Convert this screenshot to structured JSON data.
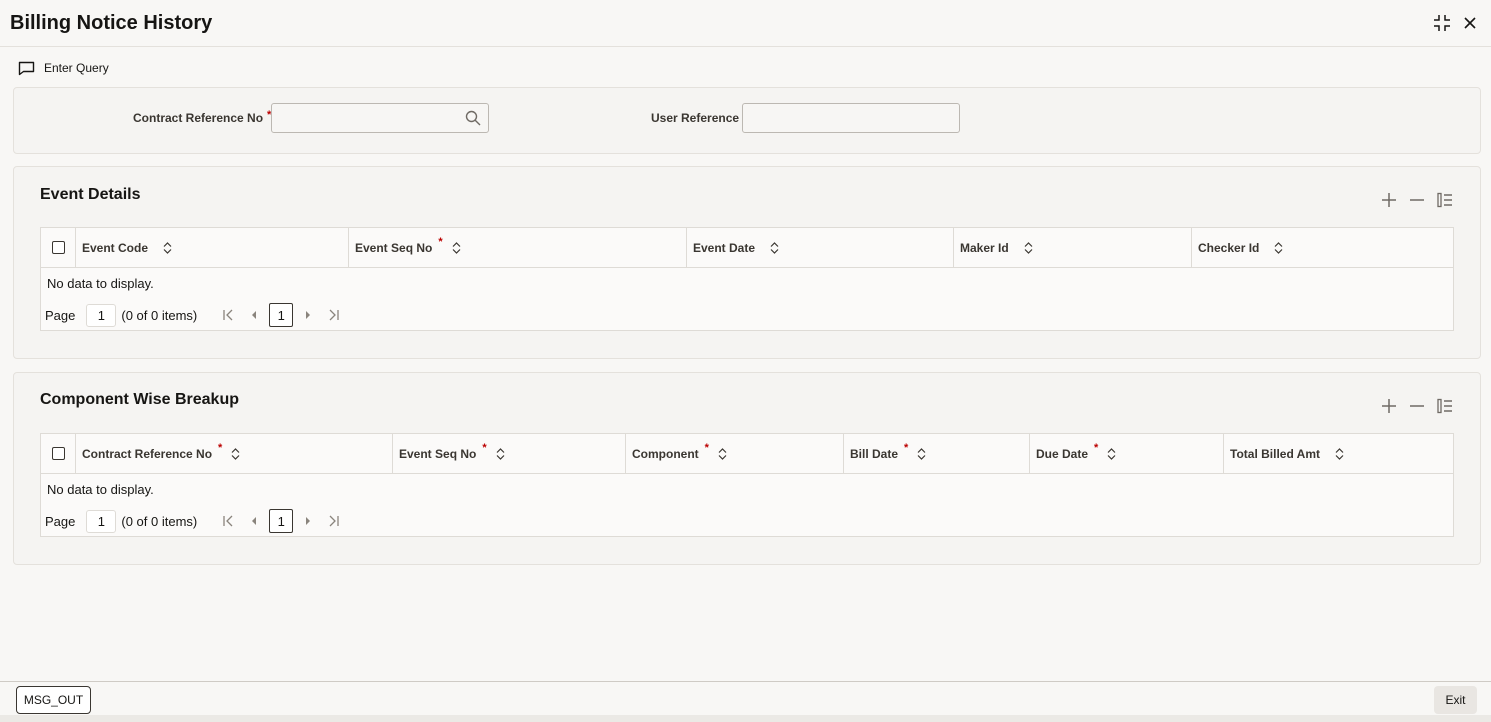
{
  "window": {
    "title": "Billing Notice History"
  },
  "toolbar": {
    "enter_query_label": "Enter Query"
  },
  "query_form": {
    "contract_ref_label": "Contract Reference No",
    "contract_ref_required": "*",
    "contract_ref_value": "",
    "user_ref_label": "User Reference",
    "user_ref_value": ""
  },
  "event_details": {
    "title": "Event Details",
    "columns": [
      {
        "label": "Event Code",
        "required": ""
      },
      {
        "label": "Event Seq No",
        "required": "*"
      },
      {
        "label": "Event Date",
        "required": ""
      },
      {
        "label": "Maker Id",
        "required": ""
      },
      {
        "label": "Checker Id",
        "required": ""
      }
    ],
    "no_data": "No data to display.",
    "pager": {
      "label": "Page",
      "page": "1",
      "items": "(0 of 0 items)",
      "current": "1"
    }
  },
  "component_breakup": {
    "title": "Component Wise Breakup",
    "columns": [
      {
        "label": "Contract Reference No",
        "required": "*"
      },
      {
        "label": "Event Seq No",
        "required": "*"
      },
      {
        "label": "Component",
        "required": "*"
      },
      {
        "label": "Bill Date",
        "required": "*"
      },
      {
        "label": "Due Date",
        "required": "*"
      },
      {
        "label": "Total Billed Amt",
        "required": ""
      }
    ],
    "no_data": "No data to display.",
    "pager": {
      "label": "Page",
      "page": "1",
      "items": "(0 of 0 items)",
      "current": "1"
    }
  },
  "footer": {
    "msg_out_label": "MSG_OUT",
    "exit_label": "Exit"
  }
}
